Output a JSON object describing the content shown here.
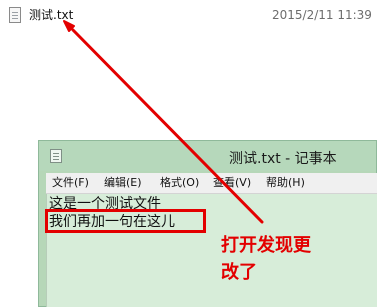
{
  "explorer": {
    "file_name": "测试.txt",
    "modified": "2015/2/11 11:39"
  },
  "notepad": {
    "title": "测试.txt - 记事本",
    "menu": [
      "文件(F)",
      "编辑(E)",
      "格式(O)",
      "查看(V)",
      "帮助(H)"
    ],
    "lines": [
      "这是一个测试文件",
      "我们再加一句在这儿"
    ]
  },
  "annotation": {
    "line1": "打开发现更",
    "line2": "改了"
  },
  "colors": {
    "highlight": "#e30000",
    "notepad_bg": "#d7edd9"
  },
  "icons": {
    "file": "text-file-icon",
    "notepad": "notepad-icon"
  }
}
